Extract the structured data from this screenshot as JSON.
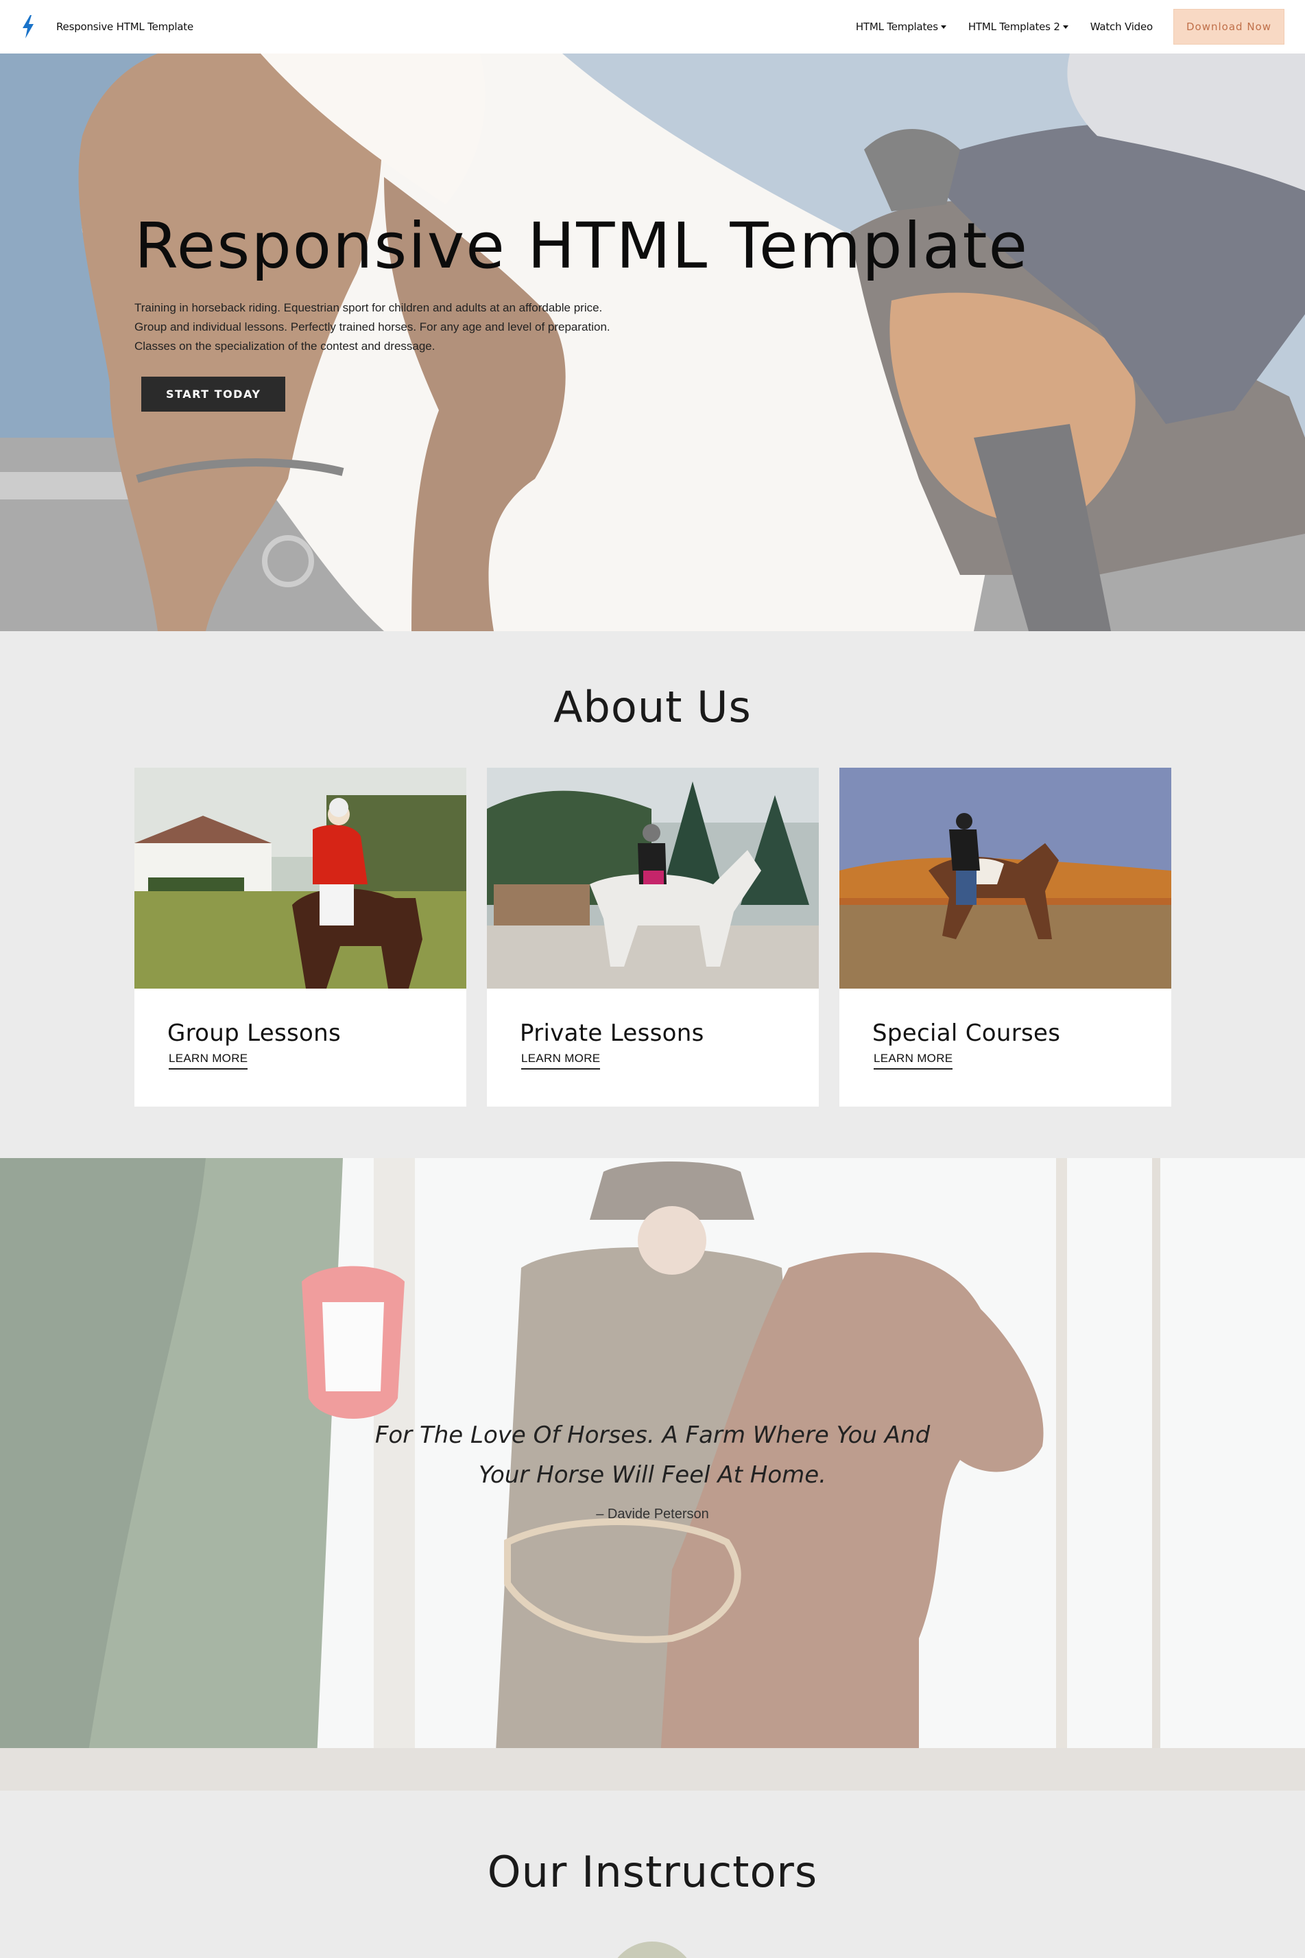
{
  "navbar": {
    "brand": "Responsive HTML Template",
    "links": [
      {
        "label": "HTML Templates",
        "dropdown": true
      },
      {
        "label": "HTML Templates 2",
        "dropdown": true
      },
      {
        "label": "Watch Video",
        "dropdown": false
      }
    ],
    "cta": "Download Now"
  },
  "hero": {
    "title": "Responsive HTML Template",
    "lines": [
      "Training in horseback riding. Equestrian sport for children and adults at an affordable price.",
      "Group and individual lessons. Perfectly trained horses. For any age and level of preparation.",
      "Classes on the specialization of the contest and dressage."
    ],
    "button": "START TODAY"
  },
  "about": {
    "title": "About Us",
    "cards": [
      {
        "title": "Group Lessons",
        "link": "LEARN MORE"
      },
      {
        "title": "Private Lessons",
        "link": "LEARN MORE"
      },
      {
        "title": "Special Courses",
        "link": "LEARN MORE"
      }
    ]
  },
  "quote": {
    "line1": "For The Love Of Horses. A Farm Where You And",
    "line2": "Your Horse Will Feel At Home.",
    "author": "– Davide Peterson"
  },
  "instructors": {
    "title": "Our Instructors"
  },
  "colors": {
    "accent_icon": "#1a73c9",
    "cta_bg": "#f8d9c4",
    "cta_text": "#c0704a",
    "dark_button": "#2b2b2b"
  }
}
